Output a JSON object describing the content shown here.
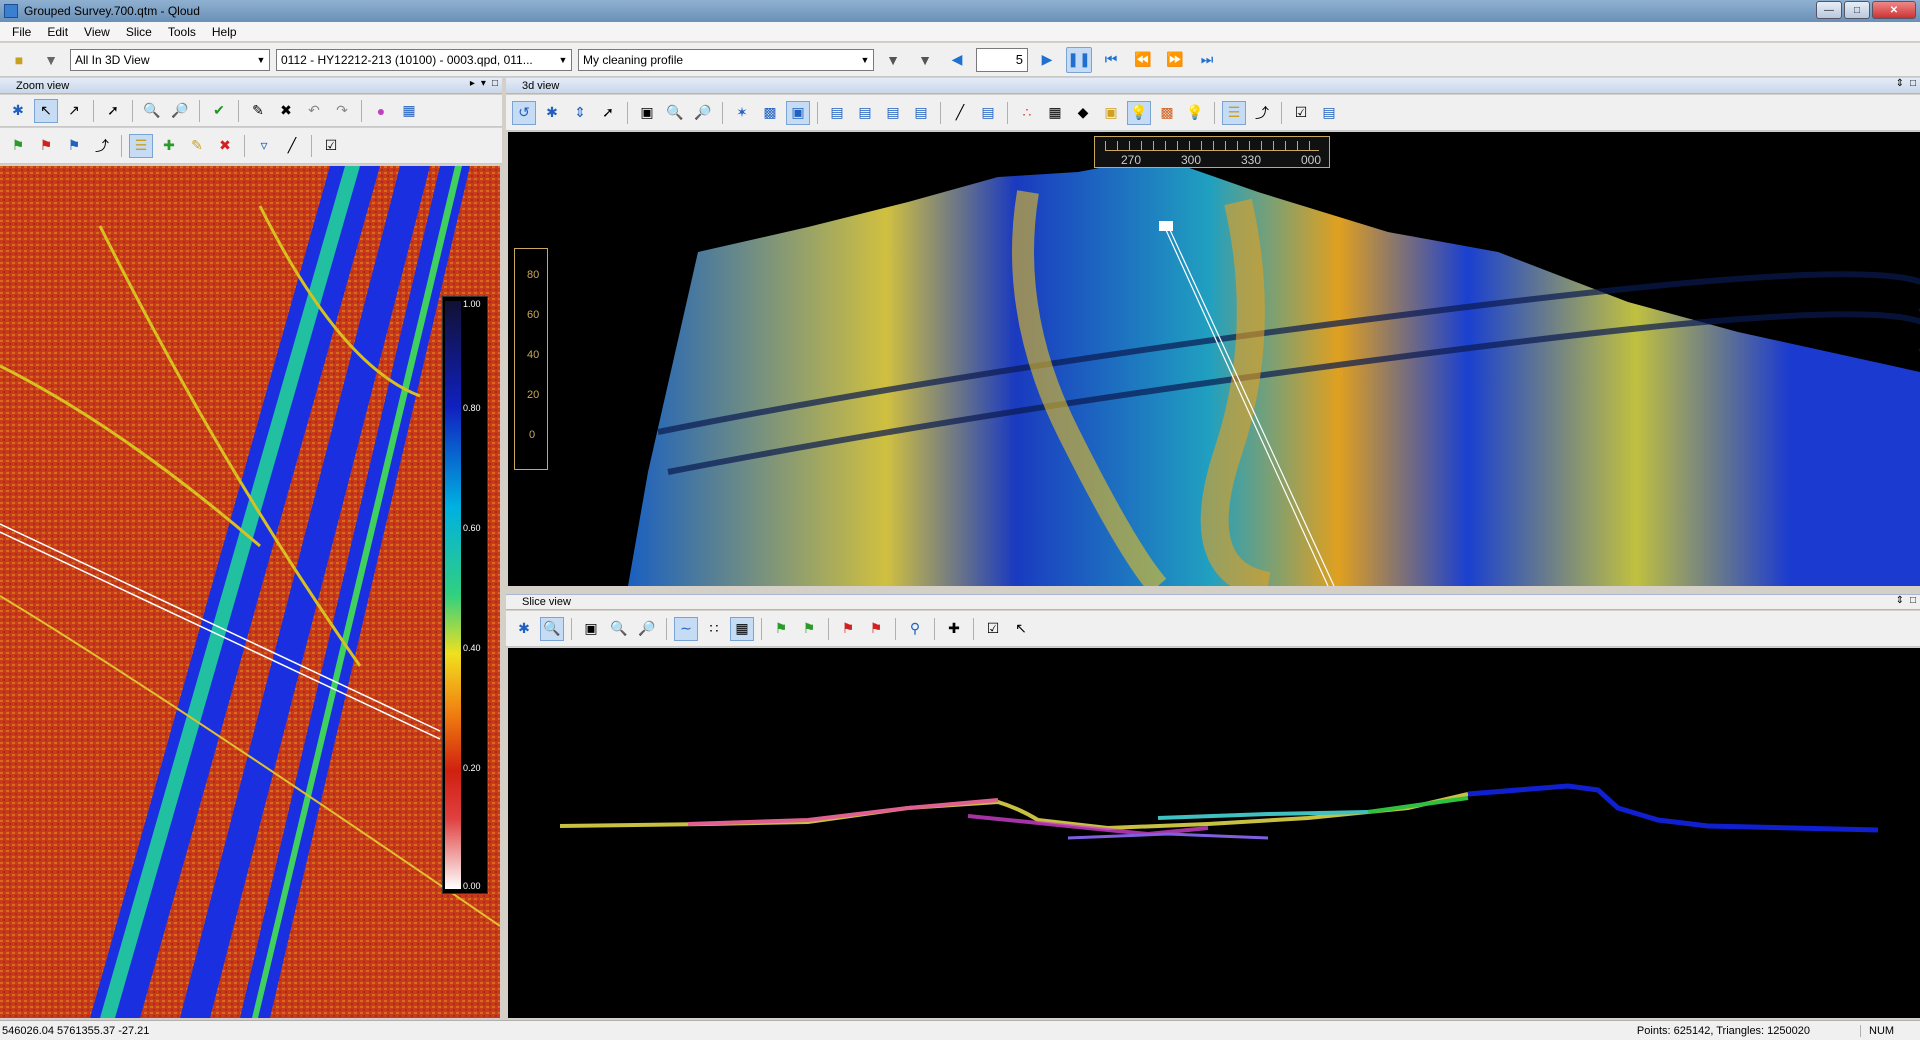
{
  "window": {
    "title": "Grouped Survey.700.qtm - Qloud"
  },
  "menu": [
    "File",
    "Edit",
    "View",
    "Slice",
    "Tools",
    "Help"
  ],
  "toolbar": {
    "view_select": "All In 3D View",
    "file_select": "0112 - HY12212-213 (10100) - 0003.qpd, 011...",
    "profile_select": "My cleaning profile",
    "step_value": "5"
  },
  "panels": {
    "zoom": "Zoom view",
    "view3d": "3d view",
    "slice": "Slice view"
  },
  "colorscale": {
    "labels": [
      "1.00",
      "0.80",
      "0.60",
      "0.40",
      "0.20",
      "0.00"
    ],
    "colors": [
      "#111133",
      "#1020c0",
      "#00b0e0",
      "#30d080",
      "#f0e020",
      "#f08010",
      "#d02010",
      "#e04040",
      "#ffffff"
    ]
  },
  "compass": [
    "270",
    "300",
    "330",
    "000"
  ],
  "depth_scale": [
    "80",
    "60",
    "40",
    "20",
    "0"
  ],
  "status": {
    "coords": "546026.04 5761355.37 -27.21",
    "counts": "Points: 625142, Triangles: 1250020",
    "num": "NUM"
  }
}
